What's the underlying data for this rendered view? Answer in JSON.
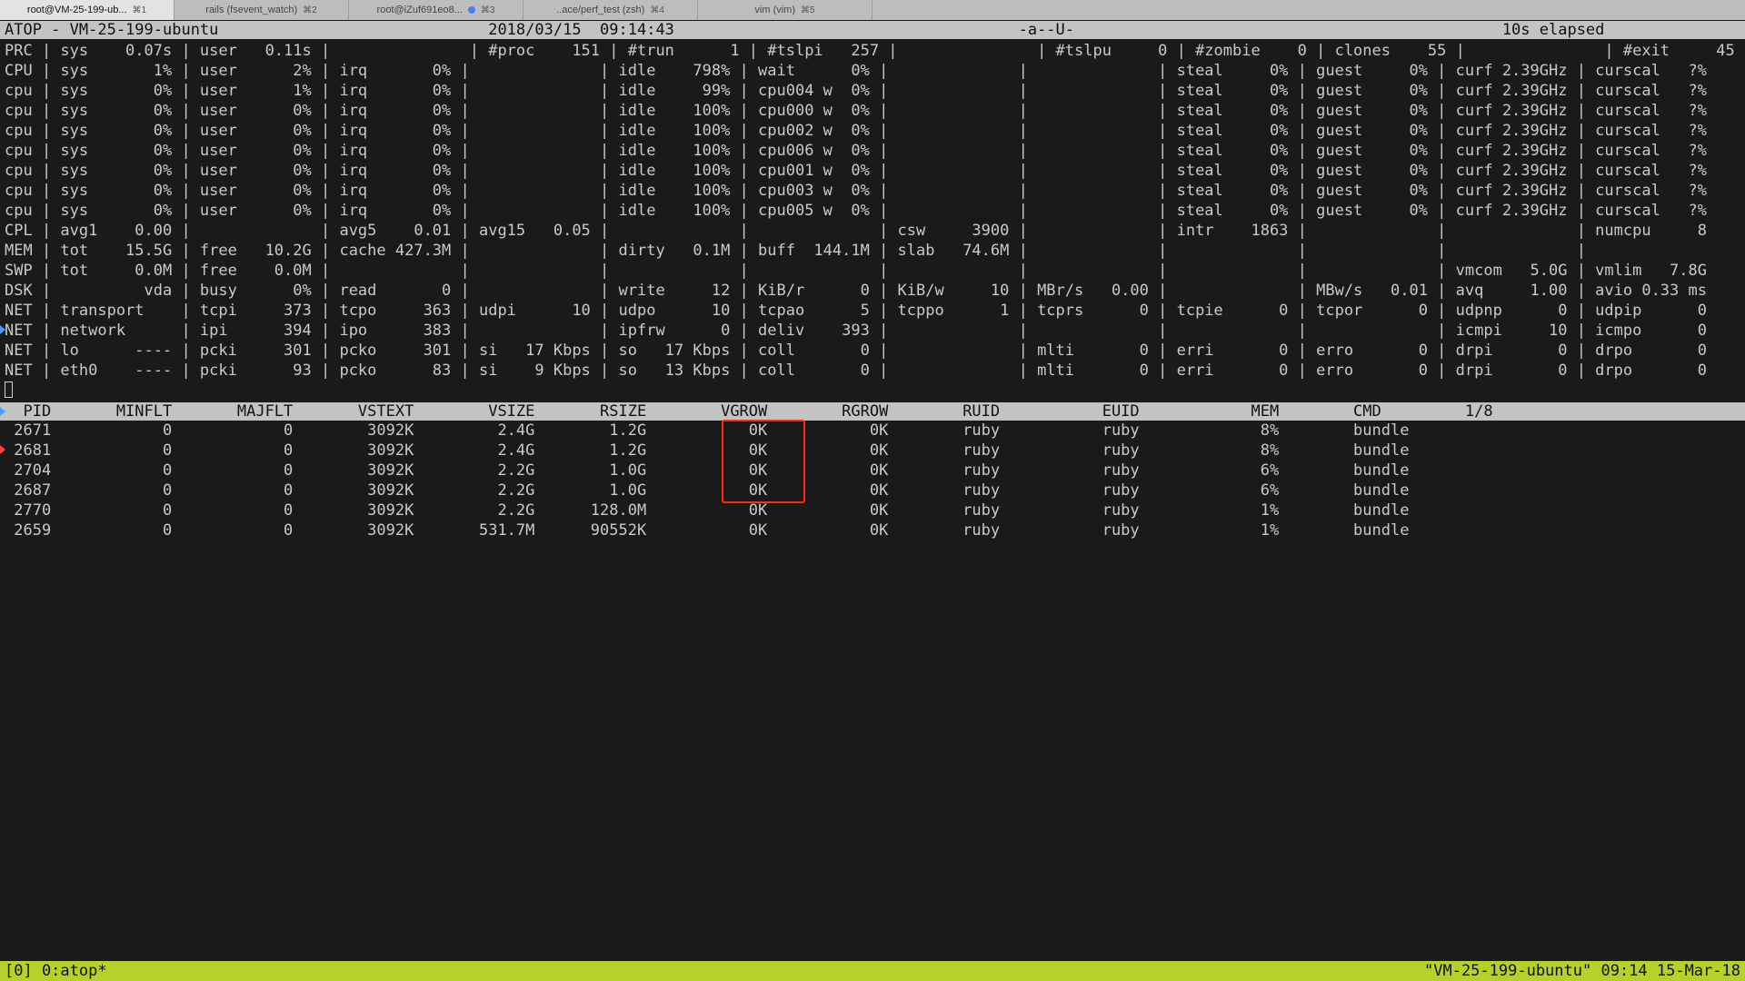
{
  "tabs": [
    {
      "title": "root@VM-25-199-ub...",
      "shortcut": "⌘1"
    },
    {
      "title": "rails (fsevent_watch)",
      "shortcut": "⌘2"
    },
    {
      "title": "root@iZuf691eo8...",
      "shortcut": "⌘3"
    },
    {
      "title": "..ace/perf_test (zsh)",
      "shortcut": "⌘4"
    },
    {
      "title": "vim (vim)",
      "shortcut": "⌘5"
    }
  ],
  "atop": {
    "header": "ATOP - VM-25-199-ubuntu                             2018/03/15  09:14:43                                     -a--U-                                              10s elapsed",
    "system_lines": [
      "PRC | sys    0.07s | user   0.11s |               | #proc    151 | #trun      1 | #tslpi   257 |               | #tslpu     0 | #zombie    0 | clones    55 |               | #exit     45",
      "CPU | sys       1% | user      2% | irq       0% |              | idle    798% | wait      0% |              |              | steal     0% | guest     0% | curf 2.39GHz | curscal   ?%",
      "cpu | sys       0% | user      1% | irq       0% |              | idle     99% | cpu004 w  0% |              |              | steal     0% | guest     0% | curf 2.39GHz | curscal   ?%",
      "cpu | sys       0% | user      0% | irq       0% |              | idle    100% | cpu000 w  0% |              |              | steal     0% | guest     0% | curf 2.39GHz | curscal   ?%",
      "cpu | sys       0% | user      0% | irq       0% |              | idle    100% | cpu002 w  0% |              |              | steal     0% | guest     0% | curf 2.39GHz | curscal   ?%",
      "cpu | sys       0% | user      0% | irq       0% |              | idle    100% | cpu006 w  0% |              |              | steal     0% | guest     0% | curf 2.39GHz | curscal   ?%",
      "cpu | sys       0% | user      0% | irq       0% |              | idle    100% | cpu001 w  0% |              |              | steal     0% | guest     0% | curf 2.39GHz | curscal   ?%",
      "cpu | sys       0% | user      0% | irq       0% |              | idle    100% | cpu003 w  0% |              |              | steal     0% | guest     0% | curf 2.39GHz | curscal   ?%",
      "cpu | sys       0% | user      0% | irq       0% |              | idle    100% | cpu005 w  0% |              |              | steal     0% | guest     0% | curf 2.39GHz | curscal   ?%",
      "CPL | avg1    0.00 |              | avg5    0.01 | avg15   0.05 |              |              | csw     3900 |              | intr    1863 |              |              | numcpu     8",
      "MEM | tot    15.5G | free   10.2G | cache 427.3M |              | dirty   0.1M | buff  144.1M | slab   74.6M |              |              |              |              |",
      "SWP | tot     0.0M | free    0.0M |              |              |              |              |              |              |              |              | vmcom   5.0G | vmlim   7.8G",
      "DSK |          vda | busy      0% | read       0 |              | write     12 | KiB/r      0 | KiB/w     10 | MBr/s   0.00 |              | MBw/s   0.01 | avq     1.00 | avio 0.33 ms",
      "NET | transport    | tcpi     373 | tcpo     363 | udpi      10 | udpo      10 | tcpao      5 | tcppo      1 | tcprs      0 | tcpie      0 | tcpor      0 | udpnp      0 | udpip      0",
      "NET | network      | ipi      394 | ipo      383 |              | ipfrw      0 | deliv    393 |              |              |              |              | icmpi     10 | icmpo      0",
      "NET | lo      ---- | pcki     301 | pcko     301 | si   17 Kbps | so   17 Kbps | coll       0 |              | mlti       0 | erri       0 | erro       0 | drpi       0 | drpo       0",
      "NET | eth0    ---- | pcki      93 | pcko      83 | si    9 Kbps | so   13 Kbps | coll       0 |              | mlti       0 | erri       0 | erro       0 | drpi       0 | drpo       0"
    ],
    "process_header": "  PID       MINFLT       MAJFLT       VSTEXT        VSIZE       RSIZE        VGROW        RGROW        RUID           EUID            MEM        CMD         1/8",
    "process_rows": [
      " 2671            0            0        3092K         2.4G        1.2G           0K           0K        ruby           ruby             8%        bundle",
      " 2681            0            0        3092K         2.4G        1.2G           0K           0K        ruby           ruby             8%        bundle",
      " 2704            0            0        3092K         2.2G        1.0G           0K           0K        ruby           ruby             6%        bundle",
      " 2687            0            0        3092K         2.2G        1.0G           0K           0K        ruby           ruby             6%        bundle",
      " 2770            0            0        3092K         2.2G      128.0M           0K           0K        ruby           ruby             1%        bundle",
      " 2659            0            0        3092K       531.7M      90552K           0K           0K        ruby           ruby             1%        bundle"
    ]
  },
  "tmux": {
    "left": "[0] 0:atop*",
    "right": "\"VM-25-199-ubuntu\" 09:14 15-Mar-18"
  }
}
